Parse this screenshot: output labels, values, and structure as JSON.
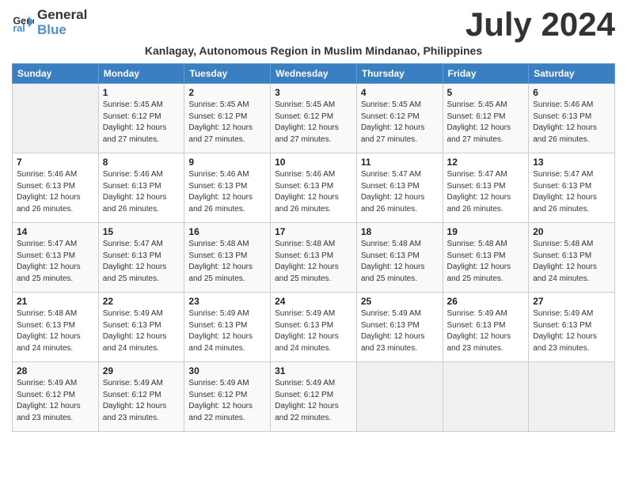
{
  "logo": {
    "line1": "General",
    "line2": "Blue"
  },
  "title": "July 2024",
  "subtitle": "Kanlagay, Autonomous Region in Muslim Mindanao, Philippines",
  "days_header": [
    "Sunday",
    "Monday",
    "Tuesday",
    "Wednesday",
    "Thursday",
    "Friday",
    "Saturday"
  ],
  "weeks": [
    [
      {
        "num": "",
        "sunrise": "",
        "sunset": "",
        "daylight": ""
      },
      {
        "num": "1",
        "sunrise": "Sunrise: 5:45 AM",
        "sunset": "Sunset: 6:12 PM",
        "daylight": "Daylight: 12 hours and 27 minutes."
      },
      {
        "num": "2",
        "sunrise": "Sunrise: 5:45 AM",
        "sunset": "Sunset: 6:12 PM",
        "daylight": "Daylight: 12 hours and 27 minutes."
      },
      {
        "num": "3",
        "sunrise": "Sunrise: 5:45 AM",
        "sunset": "Sunset: 6:12 PM",
        "daylight": "Daylight: 12 hours and 27 minutes."
      },
      {
        "num": "4",
        "sunrise": "Sunrise: 5:45 AM",
        "sunset": "Sunset: 6:12 PM",
        "daylight": "Daylight: 12 hours and 27 minutes."
      },
      {
        "num": "5",
        "sunrise": "Sunrise: 5:45 AM",
        "sunset": "Sunset: 6:12 PM",
        "daylight": "Daylight: 12 hours and 27 minutes."
      },
      {
        "num": "6",
        "sunrise": "Sunrise: 5:46 AM",
        "sunset": "Sunset: 6:13 PM",
        "daylight": "Daylight: 12 hours and 26 minutes."
      }
    ],
    [
      {
        "num": "7",
        "sunrise": "Sunrise: 5:46 AM",
        "sunset": "Sunset: 6:13 PM",
        "daylight": "Daylight: 12 hours and 26 minutes."
      },
      {
        "num": "8",
        "sunrise": "Sunrise: 5:46 AM",
        "sunset": "Sunset: 6:13 PM",
        "daylight": "Daylight: 12 hours and 26 minutes."
      },
      {
        "num": "9",
        "sunrise": "Sunrise: 5:46 AM",
        "sunset": "Sunset: 6:13 PM",
        "daylight": "Daylight: 12 hours and 26 minutes."
      },
      {
        "num": "10",
        "sunrise": "Sunrise: 5:46 AM",
        "sunset": "Sunset: 6:13 PM",
        "daylight": "Daylight: 12 hours and 26 minutes."
      },
      {
        "num": "11",
        "sunrise": "Sunrise: 5:47 AM",
        "sunset": "Sunset: 6:13 PM",
        "daylight": "Daylight: 12 hours and 26 minutes."
      },
      {
        "num": "12",
        "sunrise": "Sunrise: 5:47 AM",
        "sunset": "Sunset: 6:13 PM",
        "daylight": "Daylight: 12 hours and 26 minutes."
      },
      {
        "num": "13",
        "sunrise": "Sunrise: 5:47 AM",
        "sunset": "Sunset: 6:13 PM",
        "daylight": "Daylight: 12 hours and 26 minutes."
      }
    ],
    [
      {
        "num": "14",
        "sunrise": "Sunrise: 5:47 AM",
        "sunset": "Sunset: 6:13 PM",
        "daylight": "Daylight: 12 hours and 25 minutes."
      },
      {
        "num": "15",
        "sunrise": "Sunrise: 5:47 AM",
        "sunset": "Sunset: 6:13 PM",
        "daylight": "Daylight: 12 hours and 25 minutes."
      },
      {
        "num": "16",
        "sunrise": "Sunrise: 5:48 AM",
        "sunset": "Sunset: 6:13 PM",
        "daylight": "Daylight: 12 hours and 25 minutes."
      },
      {
        "num": "17",
        "sunrise": "Sunrise: 5:48 AM",
        "sunset": "Sunset: 6:13 PM",
        "daylight": "Daylight: 12 hours and 25 minutes."
      },
      {
        "num": "18",
        "sunrise": "Sunrise: 5:48 AM",
        "sunset": "Sunset: 6:13 PM",
        "daylight": "Daylight: 12 hours and 25 minutes."
      },
      {
        "num": "19",
        "sunrise": "Sunrise: 5:48 AM",
        "sunset": "Sunset: 6:13 PM",
        "daylight": "Daylight: 12 hours and 25 minutes."
      },
      {
        "num": "20",
        "sunrise": "Sunrise: 5:48 AM",
        "sunset": "Sunset: 6:13 PM",
        "daylight": "Daylight: 12 hours and 24 minutes."
      }
    ],
    [
      {
        "num": "21",
        "sunrise": "Sunrise: 5:48 AM",
        "sunset": "Sunset: 6:13 PM",
        "daylight": "Daylight: 12 hours and 24 minutes."
      },
      {
        "num": "22",
        "sunrise": "Sunrise: 5:49 AM",
        "sunset": "Sunset: 6:13 PM",
        "daylight": "Daylight: 12 hours and 24 minutes."
      },
      {
        "num": "23",
        "sunrise": "Sunrise: 5:49 AM",
        "sunset": "Sunset: 6:13 PM",
        "daylight": "Daylight: 12 hours and 24 minutes."
      },
      {
        "num": "24",
        "sunrise": "Sunrise: 5:49 AM",
        "sunset": "Sunset: 6:13 PM",
        "daylight": "Daylight: 12 hours and 24 minutes."
      },
      {
        "num": "25",
        "sunrise": "Sunrise: 5:49 AM",
        "sunset": "Sunset: 6:13 PM",
        "daylight": "Daylight: 12 hours and 23 minutes."
      },
      {
        "num": "26",
        "sunrise": "Sunrise: 5:49 AM",
        "sunset": "Sunset: 6:13 PM",
        "daylight": "Daylight: 12 hours and 23 minutes."
      },
      {
        "num": "27",
        "sunrise": "Sunrise: 5:49 AM",
        "sunset": "Sunset: 6:13 PM",
        "daylight": "Daylight: 12 hours and 23 minutes."
      }
    ],
    [
      {
        "num": "28",
        "sunrise": "Sunrise: 5:49 AM",
        "sunset": "Sunset: 6:12 PM",
        "daylight": "Daylight: 12 hours and 23 minutes."
      },
      {
        "num": "29",
        "sunrise": "Sunrise: 5:49 AM",
        "sunset": "Sunset: 6:12 PM",
        "daylight": "Daylight: 12 hours and 23 minutes."
      },
      {
        "num": "30",
        "sunrise": "Sunrise: 5:49 AM",
        "sunset": "Sunset: 6:12 PM",
        "daylight": "Daylight: 12 hours and 22 minutes."
      },
      {
        "num": "31",
        "sunrise": "Sunrise: 5:49 AM",
        "sunset": "Sunset: 6:12 PM",
        "daylight": "Daylight: 12 hours and 22 minutes."
      },
      {
        "num": "",
        "sunrise": "",
        "sunset": "",
        "daylight": ""
      },
      {
        "num": "",
        "sunrise": "",
        "sunset": "",
        "daylight": ""
      },
      {
        "num": "",
        "sunrise": "",
        "sunset": "",
        "daylight": ""
      }
    ]
  ]
}
